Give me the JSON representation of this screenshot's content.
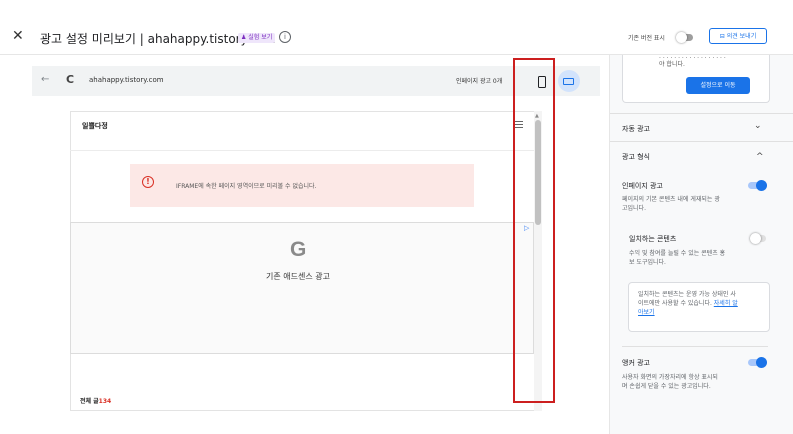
{
  "header": {
    "close_glyph": "✕",
    "title": "광고 설정 미리보기 | ahahappy.tistory.com",
    "badge": "♟ 실험 보기",
    "info_glyph": "i",
    "original_version_label": "기존 버전 표시",
    "feedback_label": "⊟ 의견 보내기"
  },
  "browser": {
    "back_glyph": "←",
    "reload_glyph": "C",
    "url": "ahahappy.tistory.com",
    "ad_count_label": "인페이지 광고 0개",
    "device_mode": "desktop"
  },
  "blog": {
    "title": "일쁠다정",
    "error_glyph": "!",
    "error_text": "IFRAME에 속한 페이지 영역이므로 미리볼 수 없습니다.",
    "ad_choice_glyph": "▷",
    "ad_logo": "G",
    "ad_label": "기존 애드센스 광고",
    "total_posts_label": "전체 글",
    "total_posts_count": "134"
  },
  "panel": {
    "card_text_line1": "· · · · · · · · · · · · · · · · · ·",
    "card_text_line2": "야 합니다.",
    "card_button": "설정으로 이동",
    "auto_ads_heading": "자동 광고",
    "ad_format_heading": "광고 형식",
    "chevron_down": "⌄",
    "chevron_up": "^",
    "inpage": {
      "label": "인페이지 광고",
      "desc_line1": "페이지의 기본 콘텐츠 내에 게재되는 광",
      "desc_line2": "고입니다.",
      "enabled": true
    },
    "matched": {
      "label": "일치하는 콘텐츠",
      "desc_line1": "수익 및 참여를 늘릴 수 있는 콘텐츠 홍",
      "desc_line2": "보 도구입니다.",
      "enabled": false
    },
    "info": {
      "line1": "일치하는 콘텐츠는 운영 가능 상태인 사",
      "line2_text": "이트에만 사용할 수 있습니다. ",
      "line2_link": "자세히 알",
      "line3_link": "아보기"
    },
    "anchor": {
      "label": "앵커 광고",
      "desc_line1": "사용자 화면의 가장자리에 항상 표시되",
      "desc_line2": "며 손쉽게 닫을 수 있는 광고입니다.",
      "enabled": true
    }
  },
  "colors": {
    "accent": "#1a73e8",
    "highlight": "#cc1f1f",
    "error_bg": "#fce8e6"
  }
}
